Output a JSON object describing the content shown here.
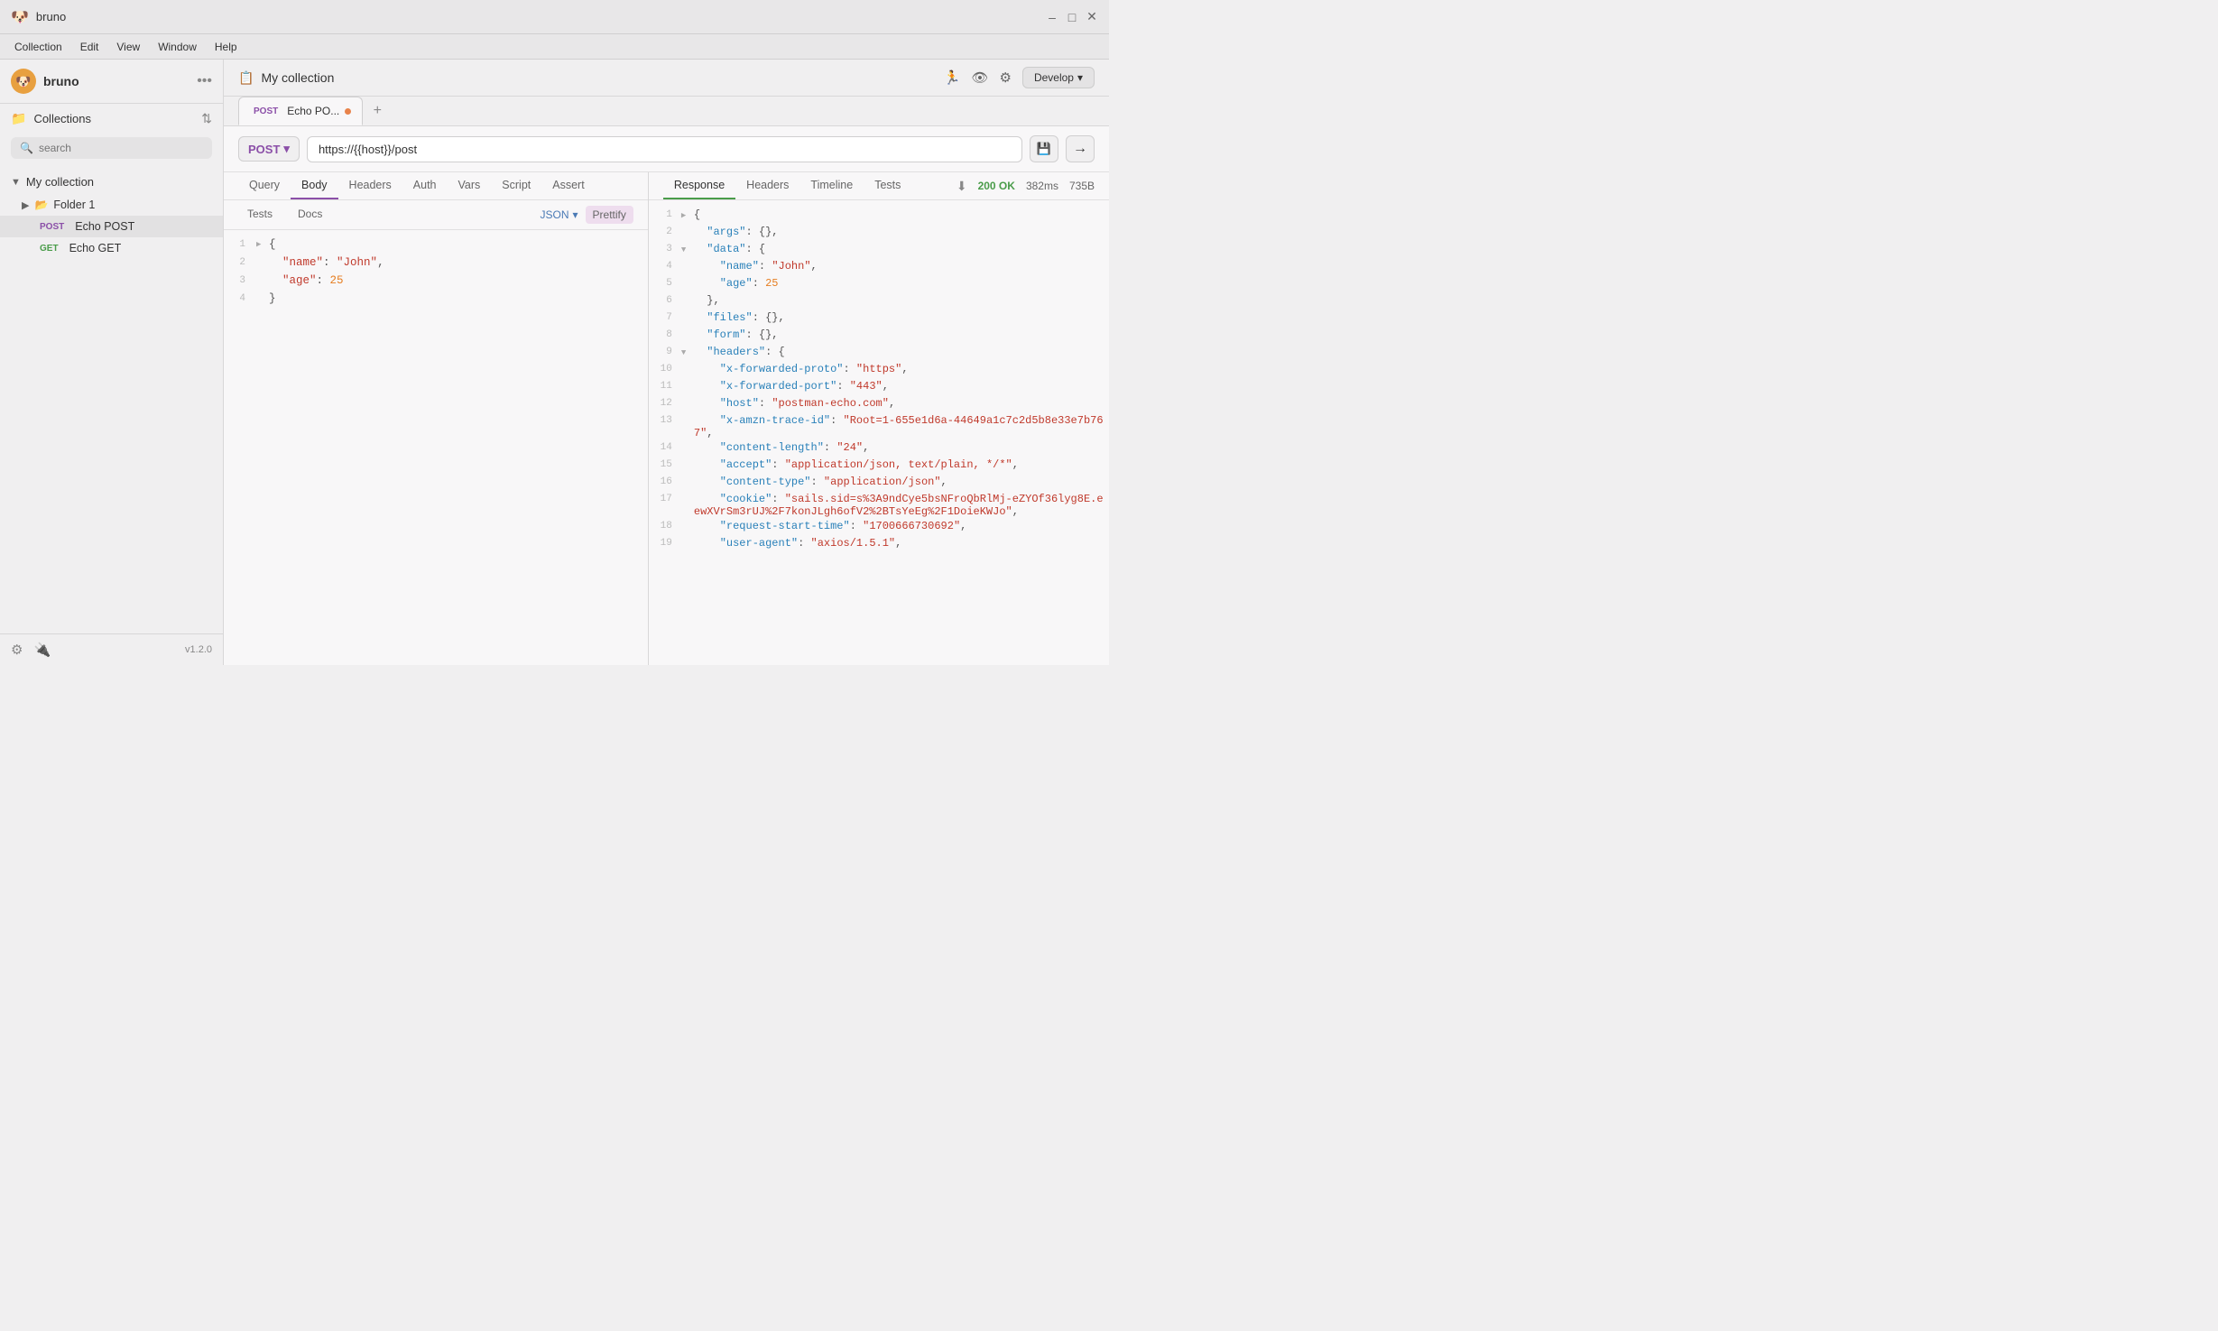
{
  "app": {
    "title": "bruno",
    "icon": "🐶"
  },
  "titlebar": {
    "minimize": "–",
    "maximize": "□",
    "close": "✕"
  },
  "menubar": {
    "items": [
      "Collection",
      "Edit",
      "View",
      "Window",
      "Help"
    ]
  },
  "sidebar": {
    "brand": "bruno",
    "more_label": "•••",
    "collections_label": "Collections",
    "search_placeholder": "search",
    "collection_name": "My collection",
    "folder_name": "Folder 1",
    "requests": [
      {
        "method": "POST",
        "name": "Echo POST",
        "active": true
      },
      {
        "method": "GET",
        "name": "Echo GET",
        "active": false
      }
    ],
    "version": "v1.2.0"
  },
  "main": {
    "collection_title": "My collection",
    "develop_label": "Develop",
    "tab": {
      "method": "POST",
      "name": "Echo PO...",
      "has_dot": true
    },
    "url": {
      "method": "POST",
      "value": "https://{{host}}/post"
    },
    "request_tabs": [
      "Query",
      "Body",
      "Headers",
      "Auth",
      "Vars",
      "Script",
      "Assert"
    ],
    "request_active_tab": "Body",
    "request_tabs2": [
      "Tests",
      "Docs"
    ],
    "format": "JSON",
    "prettify": "Prettify",
    "body_lines": [
      {
        "ln": 1,
        "arrow": "▶",
        "text": "{"
      },
      {
        "ln": 2,
        "arrow": "",
        "text": "  \"name\": \"John\","
      },
      {
        "ln": 3,
        "arrow": "",
        "text": "  \"age\": 25"
      },
      {
        "ln": 4,
        "arrow": "",
        "text": "}"
      }
    ],
    "response_tabs": [
      "Response",
      "Headers",
      "Timeline",
      "Tests"
    ],
    "response_active_tab": "Response",
    "status_code": "200 OK",
    "response_time": "382ms",
    "response_size": "735B",
    "response_lines": [
      {
        "ln": 1,
        "arrow": "▶",
        "content": "{"
      },
      {
        "ln": 2,
        "arrow": "",
        "content": "  \"args\": {},"
      },
      {
        "ln": 3,
        "arrow": "▼",
        "content": "  \"data\": {"
      },
      {
        "ln": 4,
        "arrow": "",
        "content": "    \"name\": \"John\","
      },
      {
        "ln": 5,
        "arrow": "",
        "content": "    \"age\": 25"
      },
      {
        "ln": 6,
        "arrow": "",
        "content": "  },"
      },
      {
        "ln": 7,
        "arrow": "",
        "content": "  \"files\": {},"
      },
      {
        "ln": 8,
        "arrow": "",
        "content": "  \"form\": {},"
      },
      {
        "ln": 9,
        "arrow": "▼",
        "content": "  \"headers\": {"
      },
      {
        "ln": 10,
        "arrow": "",
        "content": "    \"x-forwarded-proto\": \"https\","
      },
      {
        "ln": 11,
        "arrow": "",
        "content": "    \"x-forwarded-port\": \"443\","
      },
      {
        "ln": 12,
        "arrow": "",
        "content": "    \"host\": \"postman-echo.com\","
      },
      {
        "ln": 13,
        "arrow": "",
        "content": "    \"x-amzn-trace-id\": \"Root=1-655e1d6a-44649a1c7c2d5b8e33e7b767\","
      },
      {
        "ln": 14,
        "arrow": "",
        "content": "    \"content-length\": \"24\","
      },
      {
        "ln": 15,
        "arrow": "",
        "content": "    \"accept\": \"application/json, text/plain, */*\","
      },
      {
        "ln": 16,
        "arrow": "",
        "content": "    \"content-type\": \"application/json\","
      },
      {
        "ln": 17,
        "arrow": "",
        "content": "    \"cookie\": \"sails.sid=s%3A9ndCye5bsNFroQbRlMj-eZYOf36lyg8E.eewXVrSm3rUJ%2F7konJLgh6ofV2%2BTsYeEg%2F1DoieKWJo\","
      },
      {
        "ln": 18,
        "arrow": "",
        "content": "    \"request-start-time\": \"1700666730692\","
      },
      {
        "ln": 19,
        "arrow": "",
        "content": "    \"user-agent\": \"axios/1.5.1\","
      }
    ]
  }
}
